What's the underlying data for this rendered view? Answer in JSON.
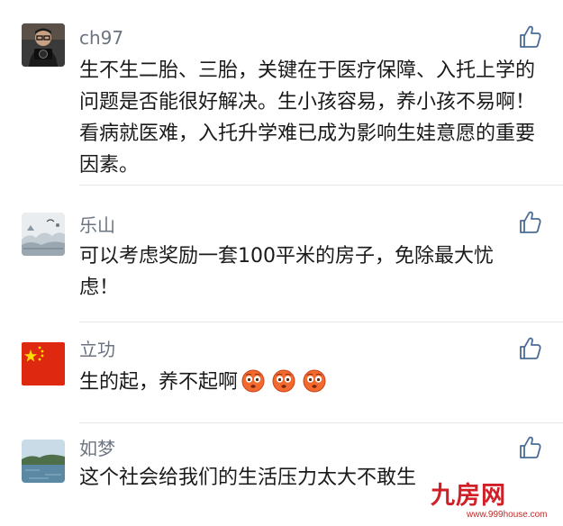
{
  "comments": [
    {
      "author": "ch97",
      "text": "生不生二胎、三胎，关键在于医疗保障、入托上学的问题是否能很好解决。生小孩容易，养小孩不易啊！看病就医难，入托升学难已成为影响生娃意愿的重要因素。",
      "avatar": "person-with-camera"
    },
    {
      "author": "乐山",
      "text": "可以考虑奖励一套100平米的房子，免除最大忧虑！",
      "avatar": "snowy-landscape"
    },
    {
      "author": "立功",
      "text": "生的起，养不起啊",
      "emoji": [
        "flushed-face",
        "flushed-face",
        "flushed-face"
      ],
      "avatar": "chinese-flag"
    },
    {
      "author": "如梦",
      "text": "这个社会给我们的生活压力太大不敢生",
      "avatar": "lake-scenery"
    }
  ],
  "like_icon": "thumbs-up-icon",
  "watermark": {
    "main": "九房网",
    "sub": "www.999house.com",
    "color": "#d01f26"
  }
}
